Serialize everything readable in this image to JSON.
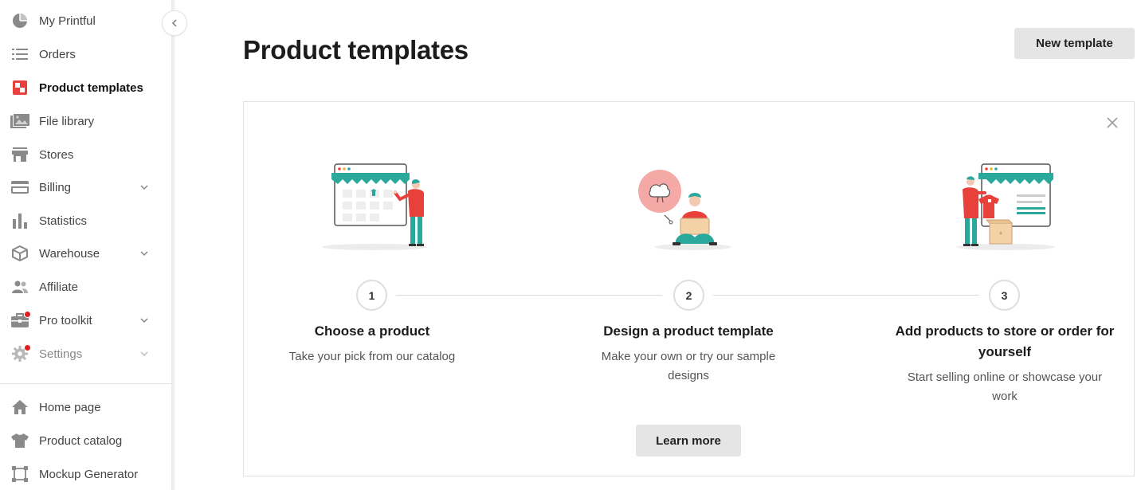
{
  "sidebar": {
    "items": [
      {
        "label": "My Printful",
        "icon": "pie-chart-icon"
      },
      {
        "label": "Orders",
        "icon": "list-icon"
      },
      {
        "label": "Product templates",
        "icon": "product-templates-icon",
        "active": true
      },
      {
        "label": "File library",
        "icon": "image-gallery-icon"
      },
      {
        "label": "Stores",
        "icon": "store-icon"
      },
      {
        "label": "Billing",
        "icon": "credit-card-icon",
        "expandable": true
      },
      {
        "label": "Statistics",
        "icon": "bar-chart-icon"
      },
      {
        "label": "Warehouse",
        "icon": "box-icon",
        "expandable": true
      },
      {
        "label": "Affiliate",
        "icon": "people-icon"
      },
      {
        "label": "Pro toolkit",
        "icon": "briefcase-icon",
        "expandable": true,
        "notification": true
      },
      {
        "label": "Settings",
        "icon": "gear-icon",
        "expandable": true,
        "notification": true
      }
    ],
    "bottom_items": [
      {
        "label": "Home page",
        "icon": "home-icon"
      },
      {
        "label": "Product catalog",
        "icon": "tshirt-icon"
      },
      {
        "label": "Mockup Generator",
        "icon": "frame-icon"
      }
    ]
  },
  "header": {
    "title": "Product templates",
    "new_template_label": "New template"
  },
  "intro_card": {
    "steps": [
      {
        "number": "1",
        "title": "Choose a product",
        "description": "Take your pick from our catalog"
      },
      {
        "number": "2",
        "title": "Design a product template",
        "description": "Make your own or try our sample designs"
      },
      {
        "number": "3",
        "title": "Add products to store or order for yourself",
        "description": "Start selling online or showcase your work"
      }
    ],
    "learn_more_label": "Learn more"
  },
  "colors": {
    "accent_red": "#e8413c",
    "teal": "#2aa89c",
    "notification_red": "#e02020"
  }
}
